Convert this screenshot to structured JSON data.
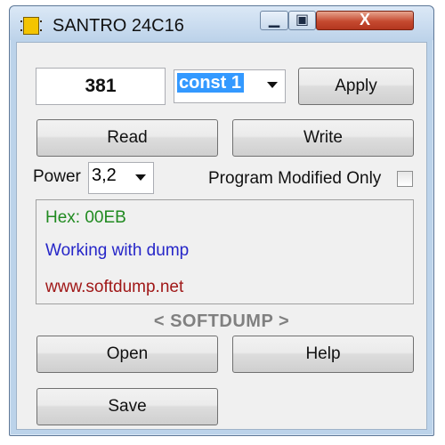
{
  "window": {
    "title": "SANTRO 24C16"
  },
  "titlebar": {
    "minimize_glyph": "▁",
    "maximize_glyph": "▣",
    "close_glyph": "X"
  },
  "controls": {
    "value": "381",
    "const_select": {
      "selected": "const 1"
    },
    "apply_label": "Apply",
    "read_label": "Read",
    "write_label": "Write",
    "power_label": "Power",
    "power_select": {
      "selected": "3,2"
    },
    "program_modified_label": "Program Modified Only",
    "program_modified_checked": false,
    "open_label": "Open",
    "help_label": "Help",
    "save_label": "Save"
  },
  "log": {
    "lines": [
      {
        "text": "Hex: 00EB",
        "color": "#208a20"
      },
      {
        "text": "Working with dump",
        "color": "#2626c8"
      },
      {
        "text": "www.softdump.net",
        "color": "#a01818"
      }
    ]
  },
  "brand_text": "< SOFTDUMP >",
  "icons": {
    "app": "chip-icon",
    "dropdown": "chevron-down-icon"
  }
}
